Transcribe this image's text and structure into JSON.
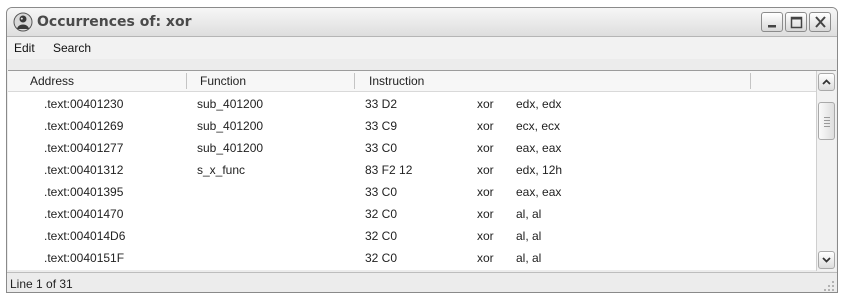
{
  "window": {
    "title": "Occurrences of: xor",
    "icon": "ida-person-icon",
    "buttons": [
      "minimize-icon",
      "maximize-icon",
      "close-icon"
    ]
  },
  "menu": {
    "edit": "Edit",
    "search": "Search"
  },
  "columns": {
    "address": "Address",
    "function": "Function",
    "instruction": "Instruction"
  },
  "rows": [
    {
      "address": ".text:00401230",
      "function": "sub_401200",
      "bytes": "33 D2",
      "mnemonic": "xor",
      "operands": "edx, edx"
    },
    {
      "address": ".text:00401269",
      "function": "sub_401200",
      "bytes": "33 C9",
      "mnemonic": "xor",
      "operands": "ecx, ecx"
    },
    {
      "address": ".text:00401277",
      "function": "sub_401200",
      "bytes": "33 C0",
      "mnemonic": "xor",
      "operands": "eax, eax"
    },
    {
      "address": ".text:00401312",
      "function": "s_x_func",
      "bytes": "83 F2 12",
      "mnemonic": "xor",
      "operands": "edx, 12h"
    },
    {
      "address": ".text:00401395",
      "function": "",
      "bytes": "33 C0",
      "mnemonic": "xor",
      "operands": "eax, eax"
    },
    {
      "address": ".text:00401470",
      "function": "",
      "bytes": "32 C0",
      "mnemonic": "xor",
      "operands": "al, al"
    },
    {
      "address": ".text:004014D6",
      "function": "",
      "bytes": "32 C0",
      "mnemonic": "xor",
      "operands": "al, al"
    },
    {
      "address": ".text:0040151F",
      "function": "",
      "bytes": "32 C0",
      "mnemonic": "xor",
      "operands": "al, al"
    }
  ],
  "status": {
    "text": "Line 1 of 31"
  }
}
